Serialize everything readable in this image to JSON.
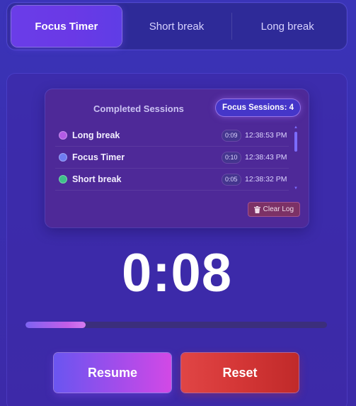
{
  "mode_tabs": [
    {
      "label": "Focus Timer",
      "active": true
    },
    {
      "label": "Short break",
      "active": false
    },
    {
      "label": "Long break",
      "active": false
    }
  ],
  "sessions": {
    "title": "Completed Sessions",
    "focus_count_label": "Focus Sessions: 4",
    "items": [
      {
        "name": "Long break",
        "duration": "0:09",
        "time": "12:38:53 PM",
        "dot_color": "#b25be6"
      },
      {
        "name": "Focus Timer",
        "duration": "0:10",
        "time": "12:38:43 PM",
        "dot_color": "#6f7cf2"
      },
      {
        "name": "Short break",
        "duration": "0:05",
        "time": "12:38:32 PM",
        "dot_color": "#3fc08a"
      }
    ],
    "clear_label": "Clear Log"
  },
  "timer": {
    "display": "0:08",
    "progress_fraction": 0.2
  },
  "controls": {
    "resume_label": "Resume",
    "reset_label": "Reset"
  },
  "colors": {
    "accent_purple": "#6a3de8",
    "reset_red": "#d43636"
  }
}
